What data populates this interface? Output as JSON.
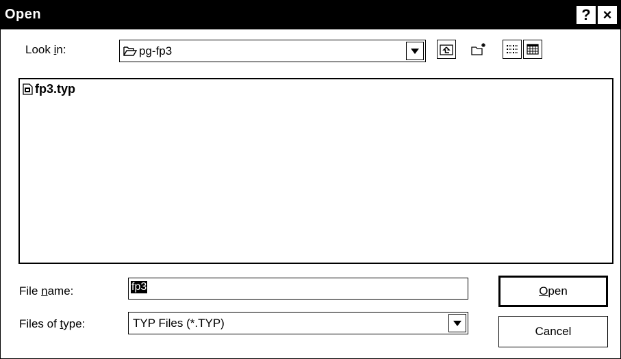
{
  "window": {
    "title": "Open",
    "help_glyph": "?",
    "close_glyph": "×"
  },
  "look_in": {
    "label_prefix": "Look ",
    "label_accel": "i",
    "label_suffix": "n:",
    "value": "pg-fp3",
    "icon": "folder-open-icon"
  },
  "toolbar": {
    "up_icon": "up-one-level-icon",
    "new_folder_icon": "new-folder-icon",
    "list_icon": "list-view-icon",
    "details_icon": "details-view-icon"
  },
  "files": [
    {
      "name": "fp3.typ",
      "icon": "document-icon"
    }
  ],
  "file_name": {
    "label_prefix": "File ",
    "label_accel": "n",
    "label_suffix": "ame:",
    "value": "fp3"
  },
  "file_type": {
    "label_prefix": "Files of ",
    "label_accel": "t",
    "label_suffix": "ype:",
    "value": "TYP Files (*.TYP)"
  },
  "buttons": {
    "open_accel": "O",
    "open_rest": "pen",
    "cancel": "Cancel"
  }
}
